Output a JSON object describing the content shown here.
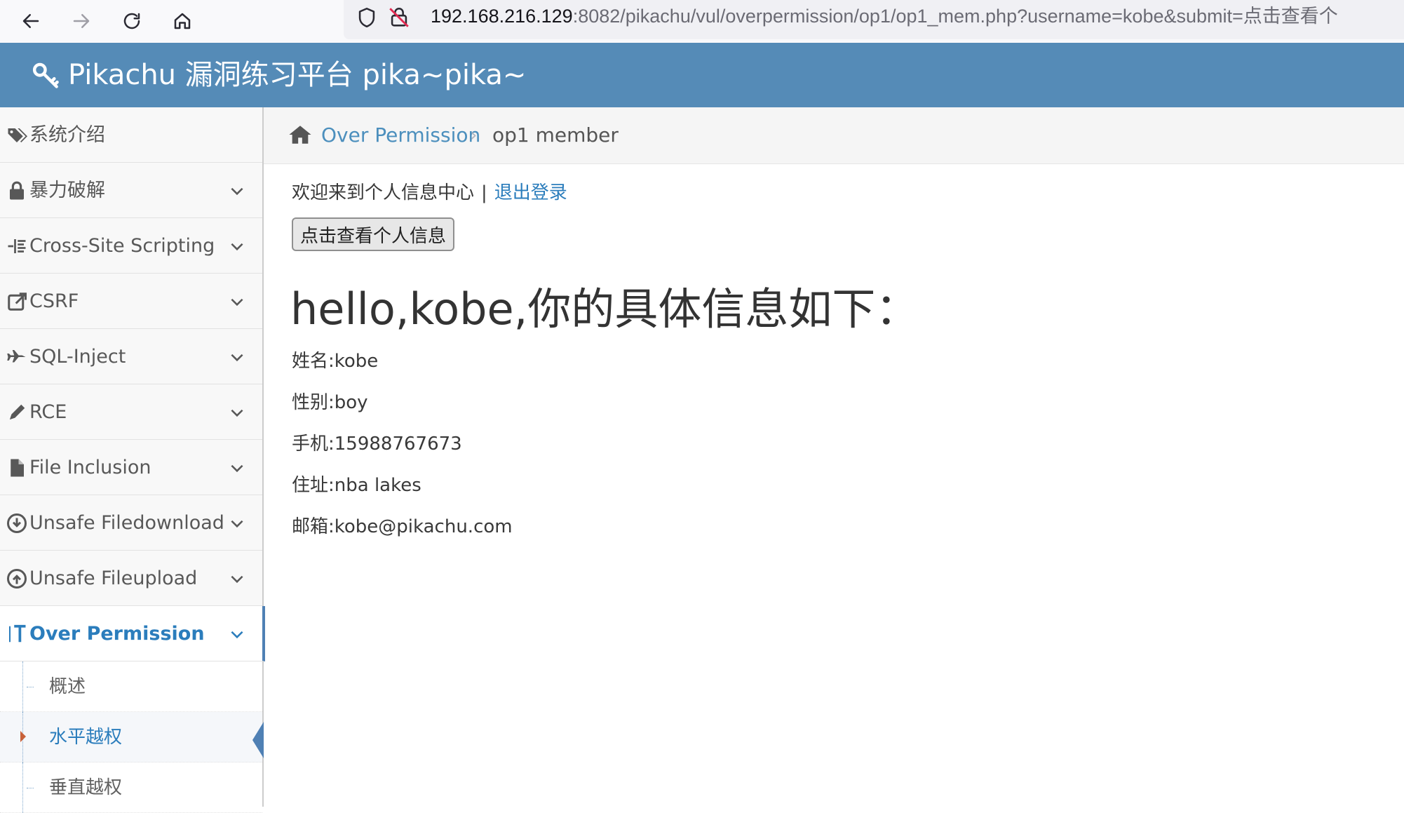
{
  "browser": {
    "url_host": "192.168.216.129",
    "url_rest": ":8082/pikachu/vul/overpermission/op1/op1_mem.php?username=kobe&submit=点击查看个"
  },
  "header": {
    "title": "Pikachu 漏洞练习平台 pika~pika~"
  },
  "sidebar": {
    "items": [
      {
        "label": "系统介绍",
        "icon": "tags-icon"
      },
      {
        "label": "暴力破解",
        "icon": "lock-icon"
      },
      {
        "label": "Cross-Site Scripting",
        "icon": "list-icon"
      },
      {
        "label": "CSRF",
        "icon": "share-icon"
      },
      {
        "label": "SQL-Inject",
        "icon": "plane-icon"
      },
      {
        "label": "RCE",
        "icon": "pencil-icon"
      },
      {
        "label": "File Inclusion",
        "icon": "file-icon"
      },
      {
        "label": "Unsafe Filedownload",
        "icon": "download-icon"
      },
      {
        "label": "Unsafe Fileupload",
        "icon": "upload-icon"
      },
      {
        "label": "Over Permission",
        "icon": "text-cursor-icon"
      }
    ],
    "subitems": [
      {
        "label": "概述"
      },
      {
        "label": "水平越权"
      },
      {
        "label": "垂直越权"
      }
    ]
  },
  "breadcrumb": {
    "section": "Over Permission",
    "separator": "›",
    "current": "op1 member"
  },
  "content": {
    "welcome": "欢迎来到个人信息中心",
    "separator": "|",
    "logout": "退出登录",
    "button_label": "点击查看个人信息",
    "greeting": "hello,kobe,你的具体信息如下：",
    "name": "姓名:kobe",
    "gender": "性别:boy",
    "phone": "手机:15988767673",
    "address": "住址:nba lakes",
    "email": "邮箱:kobe@pikachu.com"
  },
  "colors": {
    "header_bg": "#558bb7",
    "link": "#2b7dbc",
    "active_border": "#4f80b4"
  }
}
